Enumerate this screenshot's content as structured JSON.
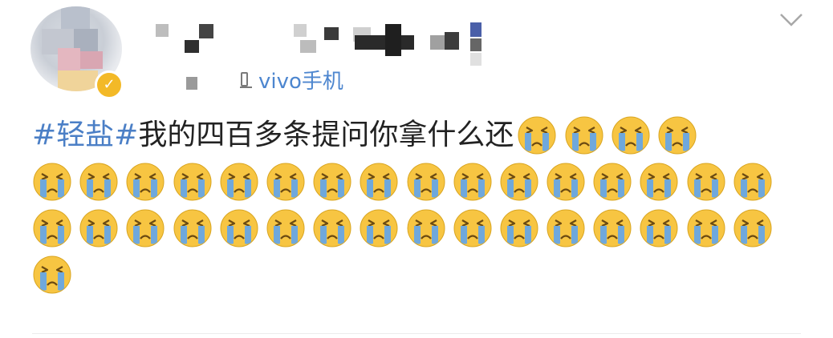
{
  "post": {
    "source_label": "vivo手机",
    "hashtag": "#轻盐#",
    "text": "我的四百多条提问你拿什么还",
    "emoji_icon": "crying-face-icon",
    "emoji_count_line1": 4,
    "emoji_rows": [
      16,
      16,
      1
    ]
  },
  "colors": {
    "link": "#4b7fc6",
    "text": "#222222",
    "emoji_face": "#f7c542",
    "emoji_tear": "#6fa8dc"
  }
}
